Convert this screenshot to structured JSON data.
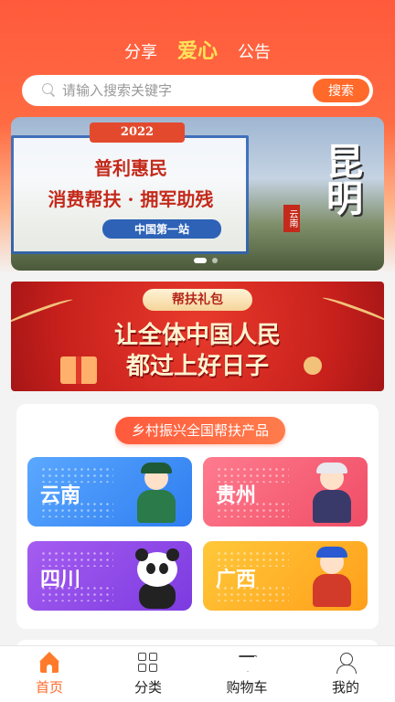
{
  "top_tabs": [
    {
      "label": "分享",
      "active": false
    },
    {
      "label": "爱心",
      "active": true
    },
    {
      "label": "公告",
      "active": false
    }
  ],
  "search": {
    "placeholder": "请输入搜索关键字",
    "button_label": "搜索"
  },
  "banner_main": {
    "year": "2022",
    "line1": "普利惠民",
    "line2": "消费帮扶 · 拥军助残",
    "tagline": "中国第一站",
    "city": "昆明",
    "province": "云南"
  },
  "banner_gift": {
    "tag": "帮扶礼包",
    "line1": "让全体中国人民",
    "line2": "都过上好日子"
  },
  "rural_section": {
    "title": "乡村振兴全国帮扶产品",
    "regions": [
      {
        "label": "云南"
      },
      {
        "label": "贵州"
      },
      {
        "label": "四川"
      },
      {
        "label": "广西"
      }
    ]
  },
  "tabbar": [
    {
      "label": "首页",
      "icon": "home-icon",
      "active": true
    },
    {
      "label": "分类",
      "icon": "category-grid-icon",
      "active": false
    },
    {
      "label": "购物车",
      "icon": "diamond-cart-icon",
      "active": false
    },
    {
      "label": "我的",
      "icon": "user-icon",
      "active": false
    }
  ],
  "colors": {
    "brand": "#ff5a3c",
    "accent": "#ff6a2a",
    "active_tab_text": "#ffe35a"
  }
}
